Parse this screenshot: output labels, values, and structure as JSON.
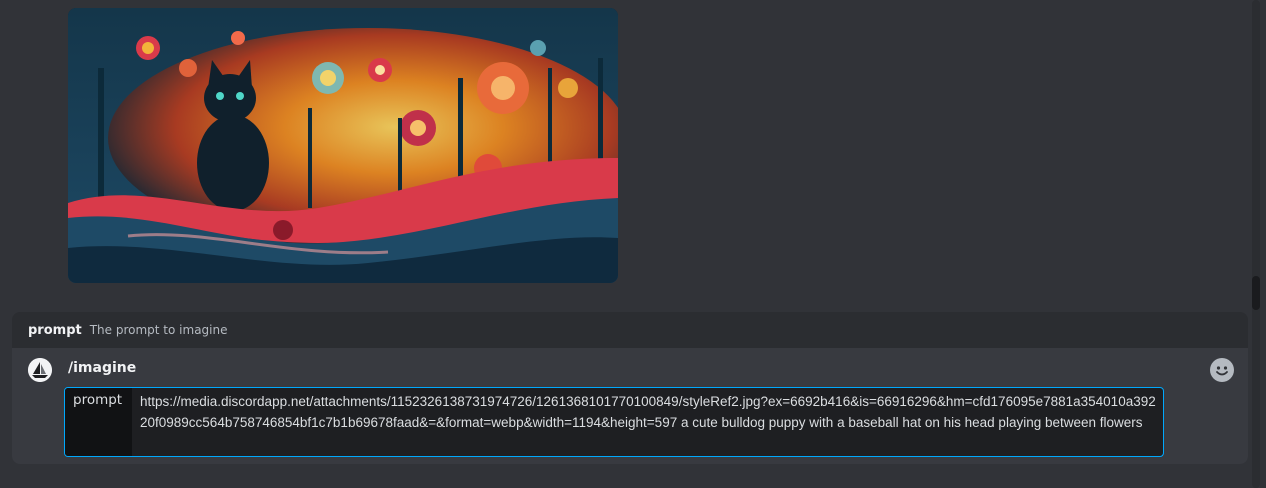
{
  "option_hint": {
    "name": "prompt",
    "description": "The prompt to imagine"
  },
  "composer": {
    "command": "/imagine",
    "param_label": "prompt",
    "param_value": "https://media.discordapp.net/attachments/1152326138731974726/1261368101770100849/styleRef2.jpg?ex=6692b416&is=66916296&hm=cfd176095e7881a354010a39220f0989cc564b758746854bf1c7b1b69678faad&=&format=webp&width=1194&height=597  a cute bulldog puppy with a baseball hat on his head playing between flowers",
    "avatar_icon": "sailboat-icon",
    "emoji_icon": "smiley-icon"
  },
  "attachment": {
    "subject": "black cat painting",
    "accent_colors": [
      "#0d2230",
      "#f28a1c",
      "#d93a4a",
      "#1e4a66"
    ]
  }
}
